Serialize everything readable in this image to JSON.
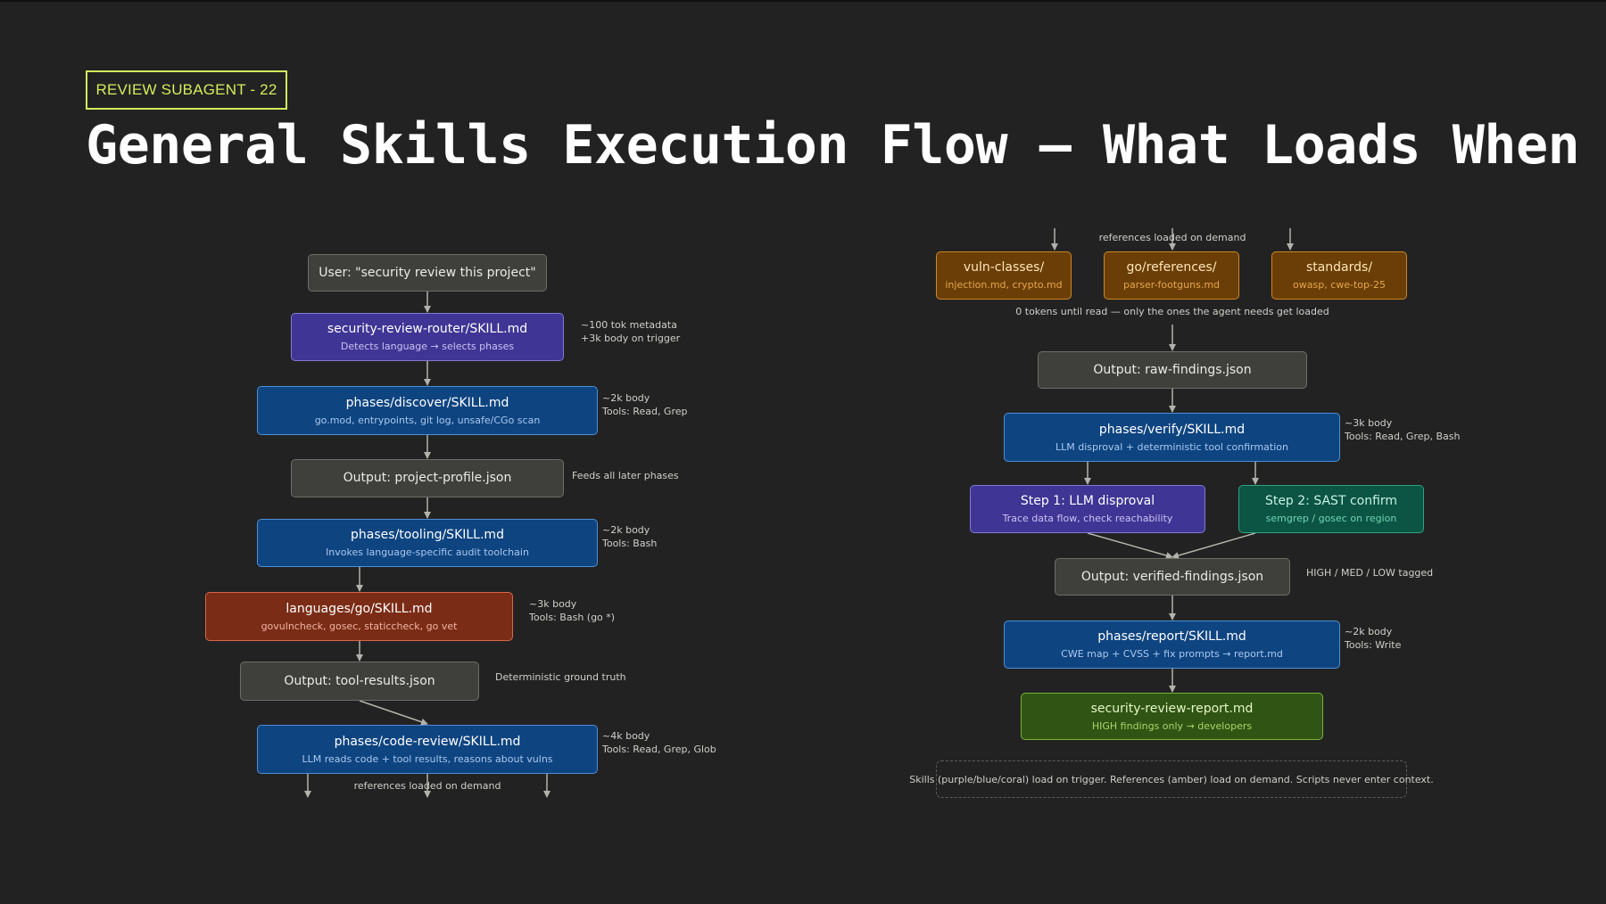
{
  "badge": "REVIEW SUBAGENT - 22",
  "title": "General Skills Execution Flow — What Loads When",
  "colors": {
    "background": "#222222",
    "badge": "#d4ec5c",
    "skill_purple": "#3f3595",
    "skill_blue": "#0e4480",
    "skill_coral": "#7a2c16",
    "reference_amber": "#6a3e06",
    "tool_teal": "#0c5443",
    "report_green": "#2f5413",
    "output_gray": "#3f3f3c",
    "arrow": "#b3b3ad"
  },
  "left_flow": {
    "user_prompt": {
      "title": "User: \"security review this project\""
    },
    "router": {
      "title": "security-review-router/SKILL.md",
      "subtitle": "Detects language → selects phases",
      "note": [
        "~100 tok metadata",
        "+3k body on trigger"
      ]
    },
    "discover": {
      "title": "phases/discover/SKILL.md",
      "subtitle": "go.mod, entrypoints, git log, unsafe/CGo scan",
      "note": [
        "~2k body",
        "Tools: Read, Grep"
      ]
    },
    "project_profile": {
      "title": "Output: project-profile.json",
      "note": [
        "Feeds all later phases"
      ]
    },
    "tooling": {
      "title": "phases/tooling/SKILL.md",
      "subtitle": "Invokes language-specific audit toolchain",
      "note": [
        "~2k body",
        "Tools: Bash"
      ]
    },
    "lang_go": {
      "title": "languages/go/SKILL.md",
      "subtitle": "govulncheck, gosec, staticcheck, go vet",
      "note": [
        "~3k body",
        "Tools: Bash (go *)"
      ]
    },
    "tool_results": {
      "title": "Output: tool-results.json",
      "note": [
        "Deterministic ground truth"
      ]
    },
    "code_review": {
      "title": "phases/code-review/SKILL.md",
      "subtitle": "LLM reads code + tool results, reasons about vulns",
      "note": [
        "~4k body",
        "Tools: Read, Grep, Glob"
      ]
    },
    "bottom_caption": "references loaded on demand"
  },
  "right_flow": {
    "top_caption": "references loaded on demand",
    "vuln_classes": {
      "title": "vuln-classes/",
      "subtitle": "injection.md, crypto.md"
    },
    "go_references": {
      "title": "go/references/",
      "subtitle": "parser-footguns.md"
    },
    "standards": {
      "title": "standards/",
      "subtitle": "owasp, cwe-top-25"
    },
    "tokens_caption": "0 tokens until read — only the ones the agent needs get loaded",
    "raw_findings": {
      "title": "Output: raw-findings.json"
    },
    "verify": {
      "title": "phases/verify/SKILL.md",
      "subtitle": "LLM disproval + deterministic tool confirmation",
      "note": [
        "~3k body",
        "Tools: Read, Grep, Bash"
      ]
    },
    "step1": {
      "title": "Step 1: LLM disproval",
      "subtitle": "Trace data flow, check reachability"
    },
    "step2": {
      "title": "Step 2: SAST confirm",
      "subtitle": "semgrep / gosec on region"
    },
    "verified_findings": {
      "title": "Output: verified-findings.json",
      "note": [
        "HIGH / MED / LOW tagged"
      ]
    },
    "report": {
      "title": "phases/report/SKILL.md",
      "subtitle": "CWE map + CVSS + fix prompts → report.md",
      "note": [
        "~2k body",
        "Tools: Write"
      ]
    },
    "final_report": {
      "title": "security-review-report.md",
      "subtitle": "HIGH findings only → developers"
    },
    "legend": "Skills (purple/blue/coral) load on trigger. References (amber) load on demand. Scripts never enter context."
  }
}
